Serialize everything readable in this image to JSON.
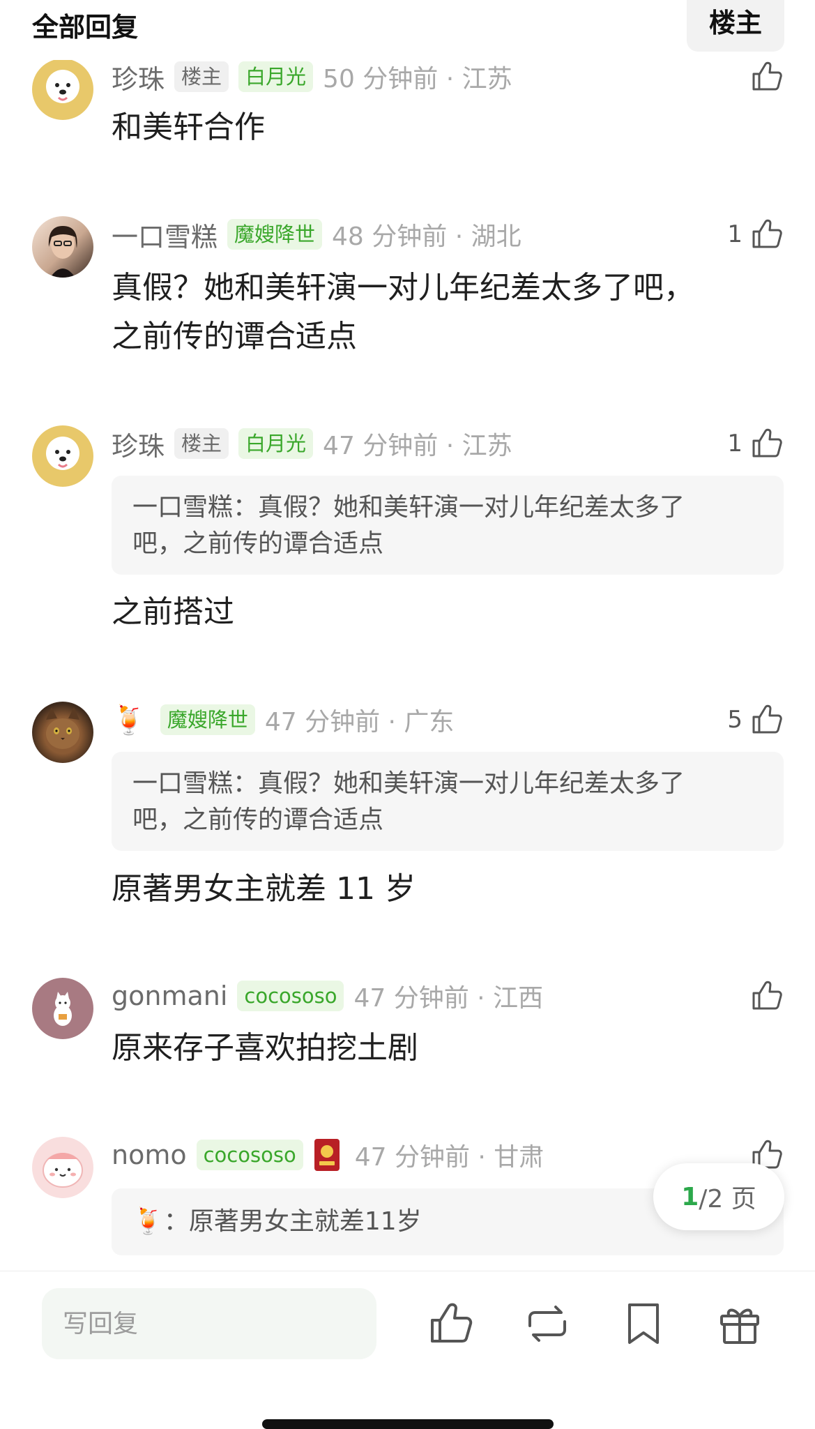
{
  "header": {
    "title": "全部回复",
    "op_filter": "楼主"
  },
  "comments": [
    {
      "user": "珍珠",
      "badges": [
        "楼主",
        "白月光"
      ],
      "time": "50 分钟前 · 江苏",
      "likes": "",
      "quote": "",
      "text": "和美轩合作"
    },
    {
      "user": "一口雪糕",
      "badges": [
        "魔嫂降世"
      ],
      "time": "48 分钟前 · 湖北",
      "likes": "1",
      "quote": "",
      "text_lines": [
        "真假？她和美轩演一对儿年纪差太多了吧，",
        "之前传的谭合适点"
      ]
    },
    {
      "user": "珍珠",
      "badges": [
        "楼主",
        "白月光"
      ],
      "time": "47 分钟前 · 江苏",
      "likes": "1",
      "quote_lines": [
        "一口雪糕：真假？她和美轩演一对儿年纪差太多了",
        "吧，之前传的谭合适点"
      ],
      "text": "之前搭过"
    },
    {
      "user": "🍹",
      "badges": [
        "魔嫂降世"
      ],
      "time": "47 分钟前 · 广东",
      "likes": "5",
      "quote_lines": [
        "一口雪糕：真假？她和美轩演一对儿年纪差太多了",
        "吧，之前传的谭合适点"
      ],
      "text": "原著男女主就差 11 岁"
    },
    {
      "user": "gonmani",
      "badges": [
        "cocososo"
      ],
      "time": "47 分钟前 · 江西",
      "likes": "",
      "text": "原来存子喜欢拍挖土剧"
    },
    {
      "user": "nomo",
      "badges": [
        "cocososo"
      ],
      "time": "47 分钟前 · 甘肃",
      "likes": "",
      "quote": "🍹：原著男女主就差11岁"
    }
  ],
  "pager": {
    "current": "1",
    "total": "/2 页"
  },
  "bottom_bar": {
    "reply_placeholder": "写回复"
  },
  "icons": [
    "thumbs-up-icon",
    "repost-icon",
    "bookmark-icon",
    "gift-icon"
  ],
  "colors": {
    "accent_green": "#3aa72b",
    "tag_green_bg": "#eaf7e4",
    "page_green": "#2ca84b"
  }
}
